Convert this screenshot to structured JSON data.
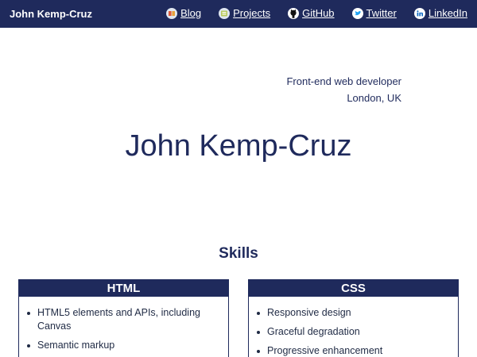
{
  "header": {
    "brand": "John Kemp-Cruz",
    "nav": [
      {
        "label": "Blog",
        "icon": "book-icon"
      },
      {
        "label": "Projects",
        "icon": "projects-icon"
      },
      {
        "label": "GitHub",
        "icon": "github-icon"
      },
      {
        "label": "Twitter",
        "icon": "twitter-icon"
      },
      {
        "label": "LinkedIn",
        "icon": "linkedin-icon"
      }
    ]
  },
  "hero": {
    "role": "Front-end web developer",
    "location": "London, UK",
    "name": "John Kemp-Cruz"
  },
  "skills": {
    "title": "Skills",
    "cards": [
      {
        "title": "HTML",
        "items": [
          "HTML5 elements and APIs, including Canvas",
          "Semantic markup"
        ]
      },
      {
        "title": "CSS",
        "items": [
          "Responsive design",
          "Graceful degradation",
          "Progressive enhancement"
        ]
      }
    ]
  },
  "colors": {
    "primary": "#1f2a5c",
    "background": "#ffffff",
    "twitter": "#1da1f2",
    "linkedin": "#0a66c2"
  }
}
